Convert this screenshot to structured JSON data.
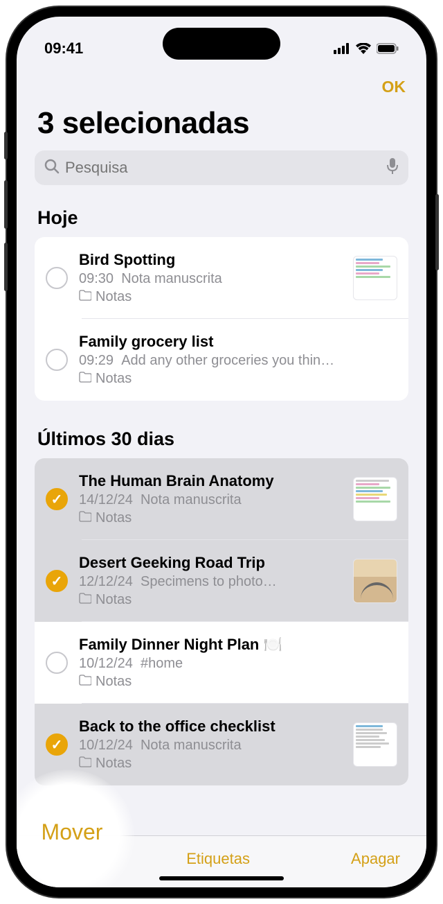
{
  "status": {
    "time": "09:41"
  },
  "nav": {
    "ok": "OK"
  },
  "header": {
    "title": "3 selecionadas"
  },
  "search": {
    "placeholder": "Pesquisa"
  },
  "sections": [
    {
      "header": "Hoje",
      "notes": [
        {
          "title": "Bird Spotting",
          "time": "09:30",
          "preview": "Nota manuscrita",
          "folder": "Notas",
          "selected": false,
          "thumb": true
        },
        {
          "title": "Family grocery list",
          "time": "09:29",
          "preview": "Add any other groceries you thin…",
          "folder": "Notas",
          "selected": false,
          "thumb": false
        }
      ]
    },
    {
      "header": "Últimos 30 dias",
      "notes": [
        {
          "title": "The Human Brain Anatomy",
          "time": "14/12/24",
          "preview": "Nota manuscrita",
          "folder": "Notas",
          "selected": true,
          "thumb": true
        },
        {
          "title": "Desert Geeking Road Trip",
          "time": "12/12/24",
          "preview": "Specimens to photo…",
          "folder": "Notas",
          "selected": true,
          "thumb": true,
          "thumbType": "road"
        },
        {
          "title": "Family Dinner Night Plan 🍽️",
          "time": "10/12/24",
          "preview": "#home",
          "folder": "Notas",
          "selected": false,
          "thumb": false
        },
        {
          "title": "Back to the office checklist",
          "time": "10/12/24",
          "preview": "Nota manuscrita",
          "folder": "Notas",
          "selected": true,
          "thumb": true
        }
      ]
    }
  ],
  "toolbar": {
    "move": "Mover",
    "tags": "Etiquetas",
    "delete": "Apagar"
  }
}
